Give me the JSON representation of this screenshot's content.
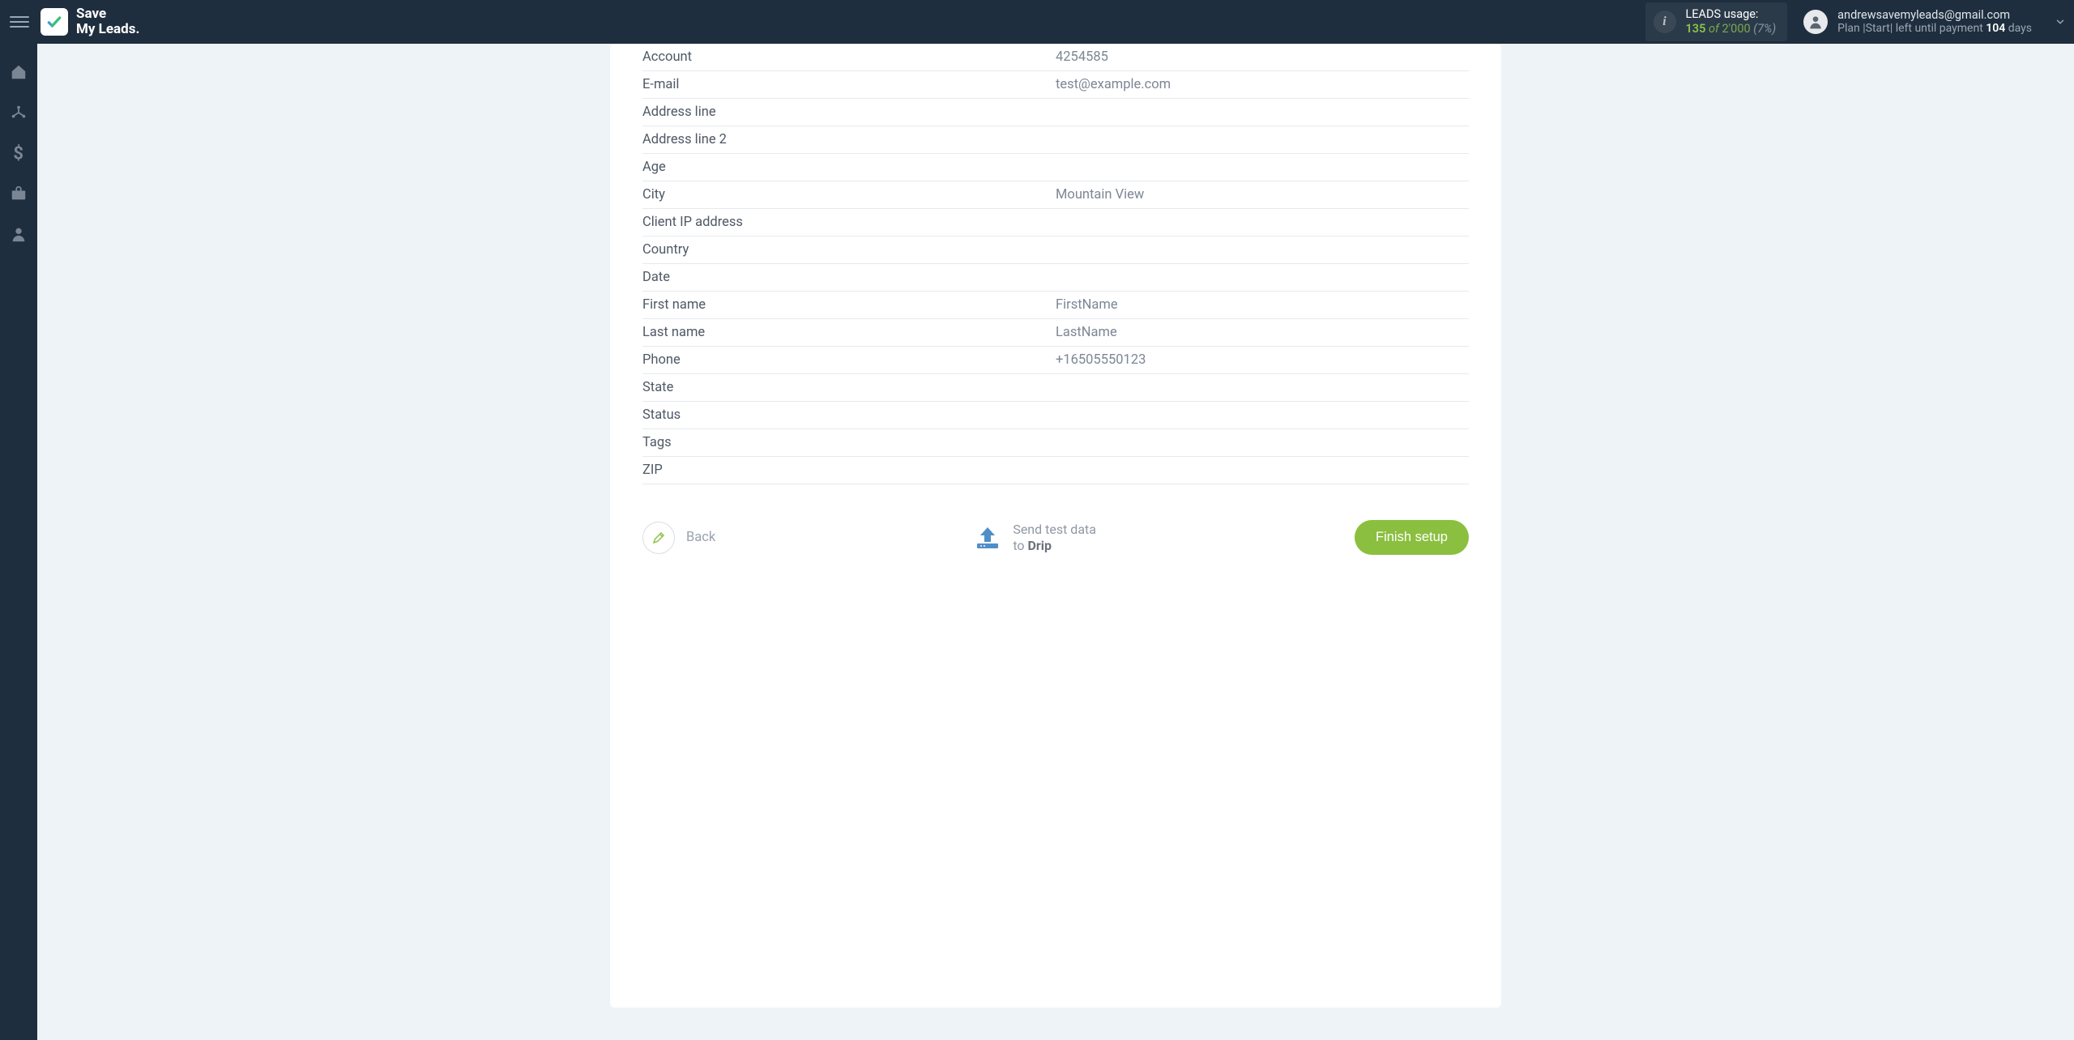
{
  "brand": {
    "name": "Save\nMy Leads."
  },
  "usage": {
    "title": "LEADS usage:",
    "used": "135",
    "of": "of",
    "total": "2'000",
    "pct": "(7%)"
  },
  "account": {
    "email": "andrewsavemyleads@gmail.com",
    "plan_pre": "Plan |Start| left until payment ",
    "days": "104",
    "days_suffix": " days"
  },
  "fields": [
    {
      "label": "Account",
      "value": "4254585"
    },
    {
      "label": "E-mail",
      "value": "test@example.com"
    },
    {
      "label": "Address line",
      "value": ""
    },
    {
      "label": "Address line 2",
      "value": ""
    },
    {
      "label": "Age",
      "value": ""
    },
    {
      "label": "City",
      "value": "Mountain View"
    },
    {
      "label": "Client IP address",
      "value": ""
    },
    {
      "label": "Country",
      "value": ""
    },
    {
      "label": "Date",
      "value": ""
    },
    {
      "label": "First name",
      "value": "FirstName"
    },
    {
      "label": "Last name",
      "value": "LastName"
    },
    {
      "label": "Phone",
      "value": "+16505550123"
    },
    {
      "label": "State",
      "value": ""
    },
    {
      "label": "Status",
      "value": ""
    },
    {
      "label": "Tags",
      "value": ""
    },
    {
      "label": "ZIP",
      "value": ""
    }
  ],
  "actions": {
    "back": "Back",
    "send_line1": "Send test data",
    "send_line2_pre": "to ",
    "send_line2_dest": "Drip",
    "finish": "Finish setup"
  }
}
